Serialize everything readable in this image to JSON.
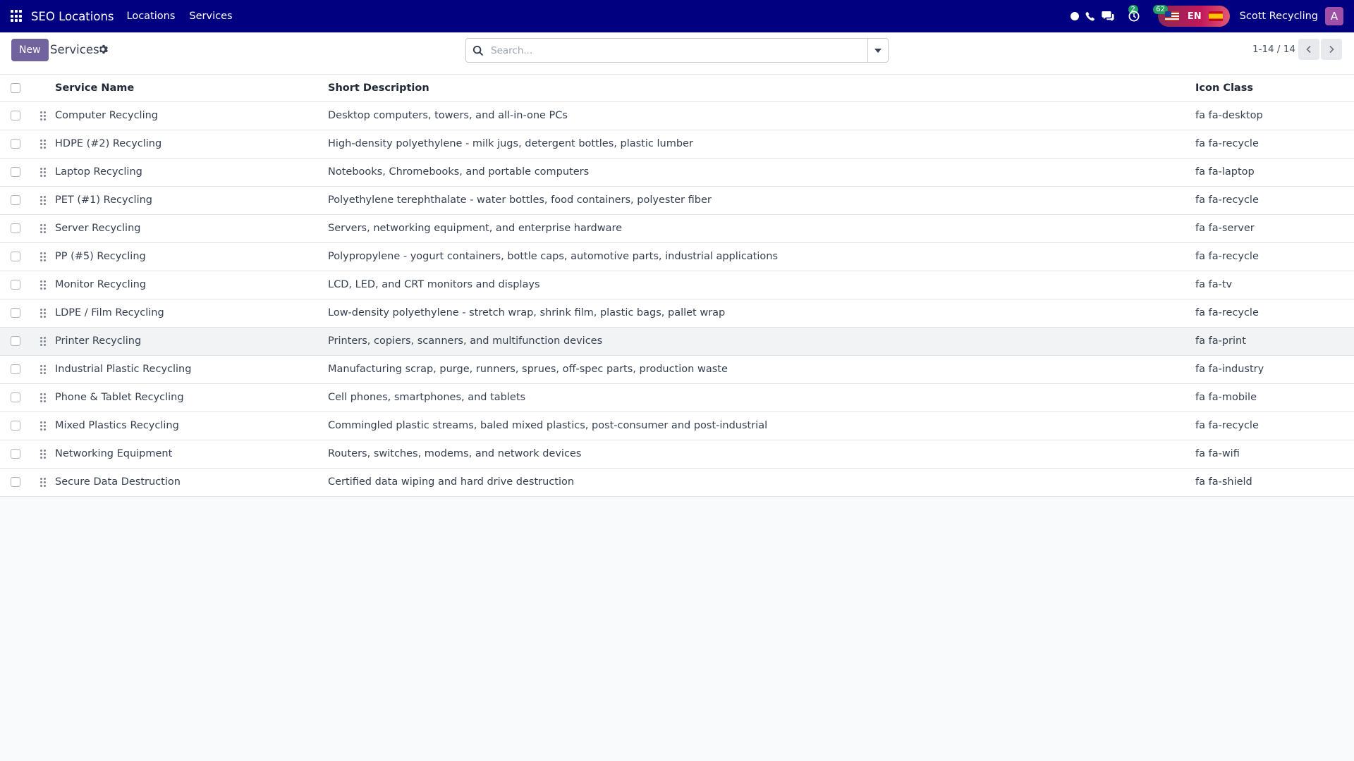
{
  "navbar": {
    "brand": "SEO Locations",
    "menu": [
      "Locations",
      "Services"
    ],
    "chat_badge": "2",
    "activity_badge": "62",
    "lang_code": "EN",
    "company": "Scott Recycling",
    "avatar_letter": "A",
    "colors": {
      "navbar_bg": "#000080",
      "badge_bg": "#23a165",
      "avatar_bg": "#a04fa6"
    }
  },
  "control_panel": {
    "new_label": "New",
    "title": "Services",
    "search_placeholder": "Search...",
    "pager": "1-14 / 14",
    "colors": {
      "primary_button": "#71639e"
    }
  },
  "table": {
    "columns": [
      "Service Name",
      "Short Description",
      "Icon Class"
    ],
    "rows": [
      {
        "name": "Computer Recycling",
        "desc": "Desktop computers, towers, and all-in-one PCs",
        "icon": "fa fa-desktop"
      },
      {
        "name": "HDPE (#2) Recycling",
        "desc": "High-density polyethylene - milk jugs, detergent bottles, plastic lumber",
        "icon": "fa fa-recycle"
      },
      {
        "name": "Laptop Recycling",
        "desc": "Notebooks, Chromebooks, and portable computers",
        "icon": "fa fa-laptop"
      },
      {
        "name": "PET (#1) Recycling",
        "desc": "Polyethylene terephthalate - water bottles, food containers, polyester fiber",
        "icon": "fa fa-recycle"
      },
      {
        "name": "Server Recycling",
        "desc": "Servers, networking equipment, and enterprise hardware",
        "icon": "fa fa-server"
      },
      {
        "name": "PP (#5) Recycling",
        "desc": "Polypropylene - yogurt containers, bottle caps, automotive parts, industrial applications",
        "icon": "fa fa-recycle"
      },
      {
        "name": "Monitor Recycling",
        "desc": "LCD, LED, and CRT monitors and displays",
        "icon": "fa fa-tv"
      },
      {
        "name": "LDPE / Film Recycling",
        "desc": "Low-density polyethylene - stretch wrap, shrink film, plastic bags, pallet wrap",
        "icon": "fa fa-recycle"
      },
      {
        "name": "Printer Recycling",
        "desc": "Printers, copiers, scanners, and multifunction devices",
        "icon": "fa fa-print"
      },
      {
        "name": "Industrial Plastic Recycling",
        "desc": "Manufacturing scrap, purge, runners, sprues, off-spec parts, production waste",
        "icon": "fa fa-industry"
      },
      {
        "name": "Phone & Tablet Recycling",
        "desc": "Cell phones, smartphones, and tablets",
        "icon": "fa fa-mobile"
      },
      {
        "name": "Mixed Plastics Recycling",
        "desc": "Commingled plastic streams, baled mixed plastics, post-consumer and post-industrial",
        "icon": "fa fa-recycle"
      },
      {
        "name": "Networking Equipment",
        "desc": "Routers, switches, modems, and network devices",
        "icon": "fa fa-wifi"
      },
      {
        "name": "Secure Data Destruction",
        "desc": "Certified data wiping and hard drive destruction",
        "icon": "fa fa-shield"
      }
    ]
  }
}
